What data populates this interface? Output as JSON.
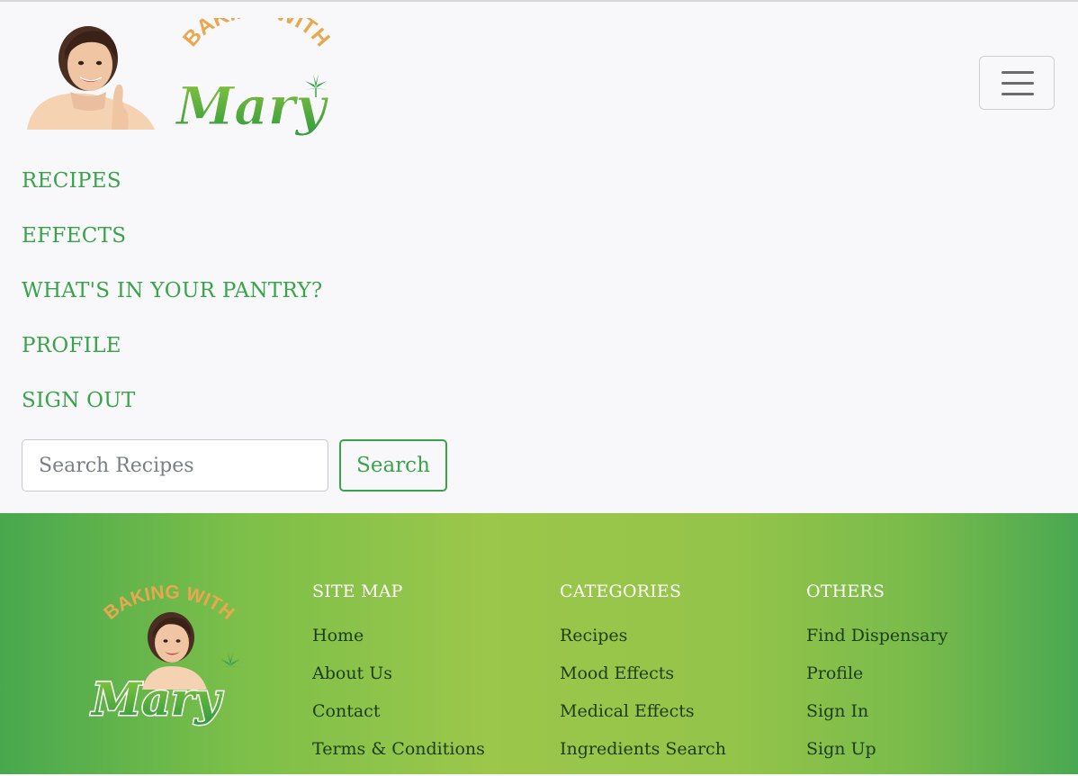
{
  "brand": {
    "logo_text_top": "BAKING WITH",
    "logo_text_main": "Mary"
  },
  "nav": {
    "items": [
      {
        "label": "RECIPES"
      },
      {
        "label": "EFFECTS"
      },
      {
        "label": "WHAT'S IN YOUR PANTRY?"
      },
      {
        "label": "PROFILE"
      },
      {
        "label": "SIGN OUT"
      }
    ],
    "menu_icon": "hamburger-icon"
  },
  "search": {
    "placeholder": "Search Recipes",
    "value": "",
    "button_label": "Search"
  },
  "footer": {
    "logo_text_top": "BAKING WITH",
    "logo_text_main": "Mary",
    "columns": [
      {
        "heading": "SITE MAP",
        "links": [
          "Home",
          "About Us",
          "Contact",
          "Terms & Conditions"
        ]
      },
      {
        "heading": "CATEGORIES",
        "links": [
          "Recipes",
          "Mood Effects",
          "Medical Effects",
          "Ingredients Search"
        ]
      },
      {
        "heading": "OTHERS",
        "links": [
          "Find Dispensary",
          "Profile",
          "Sign In",
          "Sign Up"
        ]
      }
    ]
  },
  "colors": {
    "accent_green": "#38a34a",
    "footer_gradient_start": "#48a84e",
    "footer_gradient_mid": "#9bc74a",
    "logo_orange": "#e8a850"
  }
}
